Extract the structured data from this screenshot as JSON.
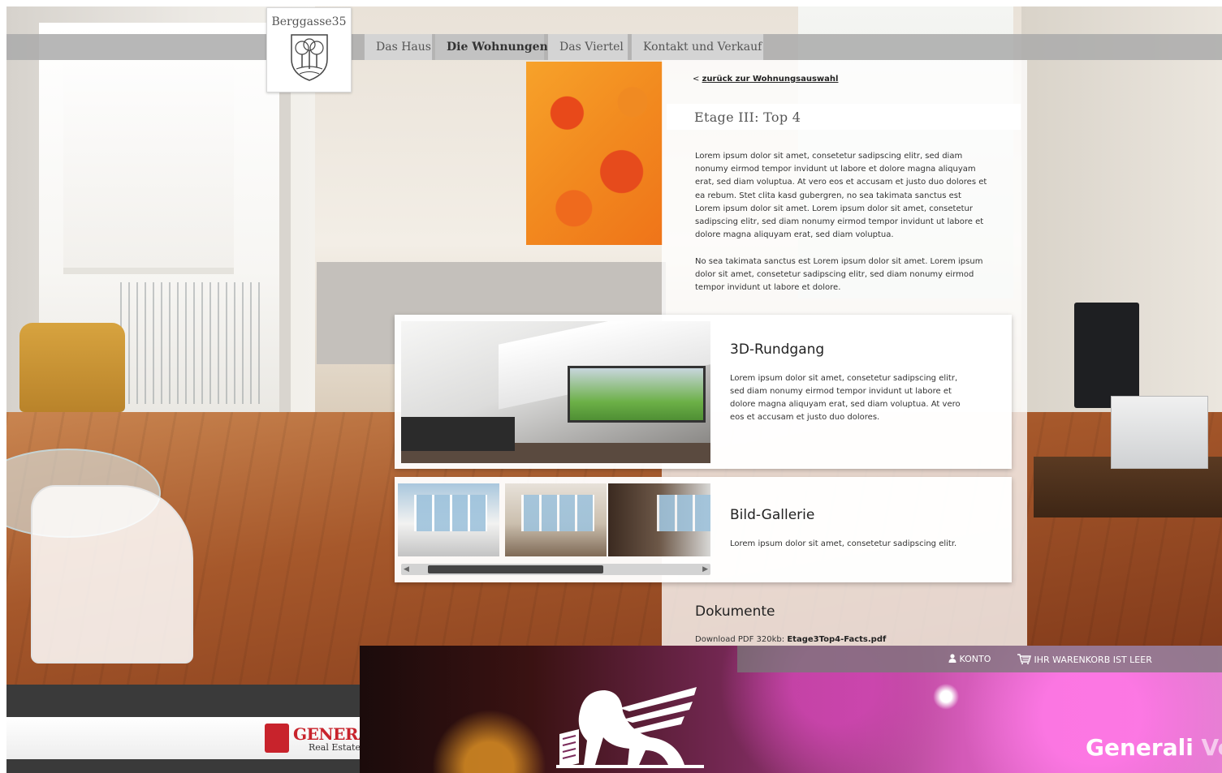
{
  "brand": {
    "logo_text": "Berggasse35"
  },
  "nav": {
    "tabs": [
      {
        "label": "Das Haus",
        "active": false
      },
      {
        "label": "Die Wohnungen",
        "active": true
      },
      {
        "label": "Das Viertel",
        "active": false
      },
      {
        "label": "Kontakt und Verkauf",
        "active": false
      }
    ]
  },
  "content": {
    "back_prefix": "<",
    "back_link": "zurück zur Wohnungsauswahl",
    "title": "Etage III: Top 4",
    "paragraph1": "Lorem ipsum dolor sit amet, consetetur sadipscing elitr, sed diam nonumy eirmod tempor invidunt ut labore et dolore magna aliquyam erat, sed diam voluptua. At vero eos et accusam et justo duo dolores et ea rebum. Stet clita kasd gubergren, no sea takimata sanctus est Lorem ipsum dolor sit amet. Lorem ipsum dolor sit amet, consetetur sadipscing elitr, sed diam nonumy eirmod tempor invidunt ut labore et dolore magna aliquyam erat, sed diam voluptua.",
    "paragraph2": "No sea takimata sanctus est Lorem ipsum dolor sit amet. Lorem ipsum dolor sit amet, consetetur sadipscing elitr, sed diam nonumy eirmod tempor invidunt ut labore et dolore."
  },
  "cards": {
    "tour": {
      "title": "3D-Rundgang",
      "text": "Lorem ipsum dolor sit amet, consetetur sadipscing elitr, sed diam nonumy eirmod tempor invidunt ut labore et dolore magna aliquyam erat, sed diam voluptua. At vero eos et accusam et justo duo dolores."
    },
    "gallery": {
      "title": "Bild-Gallerie",
      "text": "Lorem ipsum dolor sit amet, consetetur sadipscing elitr.",
      "scroll_left": "◀",
      "scroll_right": "▶"
    }
  },
  "documents": {
    "heading": "Dokumente",
    "download_label": "Download PDF 320kb:",
    "file_name": "Etage3Top4-Facts.pdf"
  },
  "footer": {
    "company": "GENERALI",
    "company_sub": "Real Estate"
  },
  "overlay_page": {
    "account_label": "KONTO",
    "cart_label": "IHR WARENKORB IST LEER",
    "brand_word": "Generali",
    "brand_tail": "Vo"
  },
  "icons": [
    "crest-icon",
    "user-icon",
    "cart-icon",
    "lion-logo-icon"
  ],
  "colors": {
    "accent_red": "#c8232c",
    "nav_grey": "#aaaaaa",
    "overlay_pink": "#d45ab8"
  }
}
